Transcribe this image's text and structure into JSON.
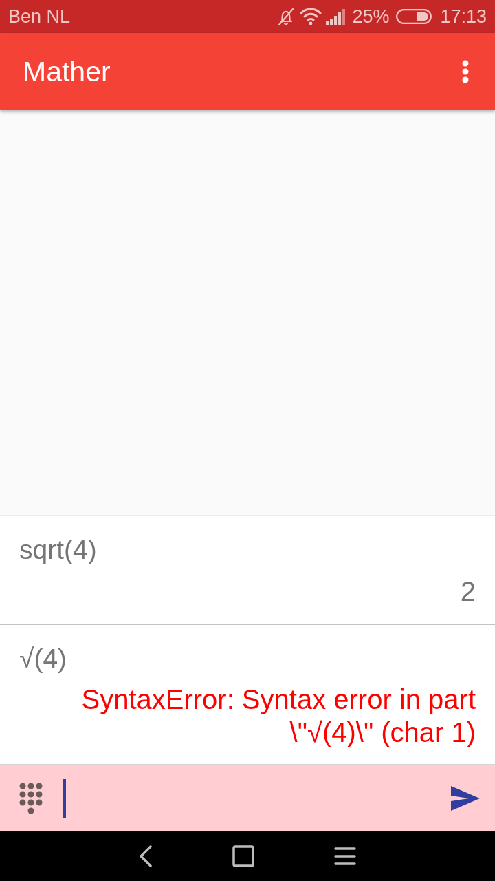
{
  "status_bar": {
    "carrier": "Ben NL",
    "battery": "25%",
    "time": "17:13"
  },
  "app_bar": {
    "title": "Mather"
  },
  "history": [
    {
      "expression": "sqrt(4)",
      "output": "2",
      "kind": "result"
    },
    {
      "expression": "√(4)",
      "output": "SyntaxError: Syntax error in part \\\"√(4)\\\" (char 1)",
      "kind": "error"
    }
  ],
  "input": {
    "error": true
  }
}
